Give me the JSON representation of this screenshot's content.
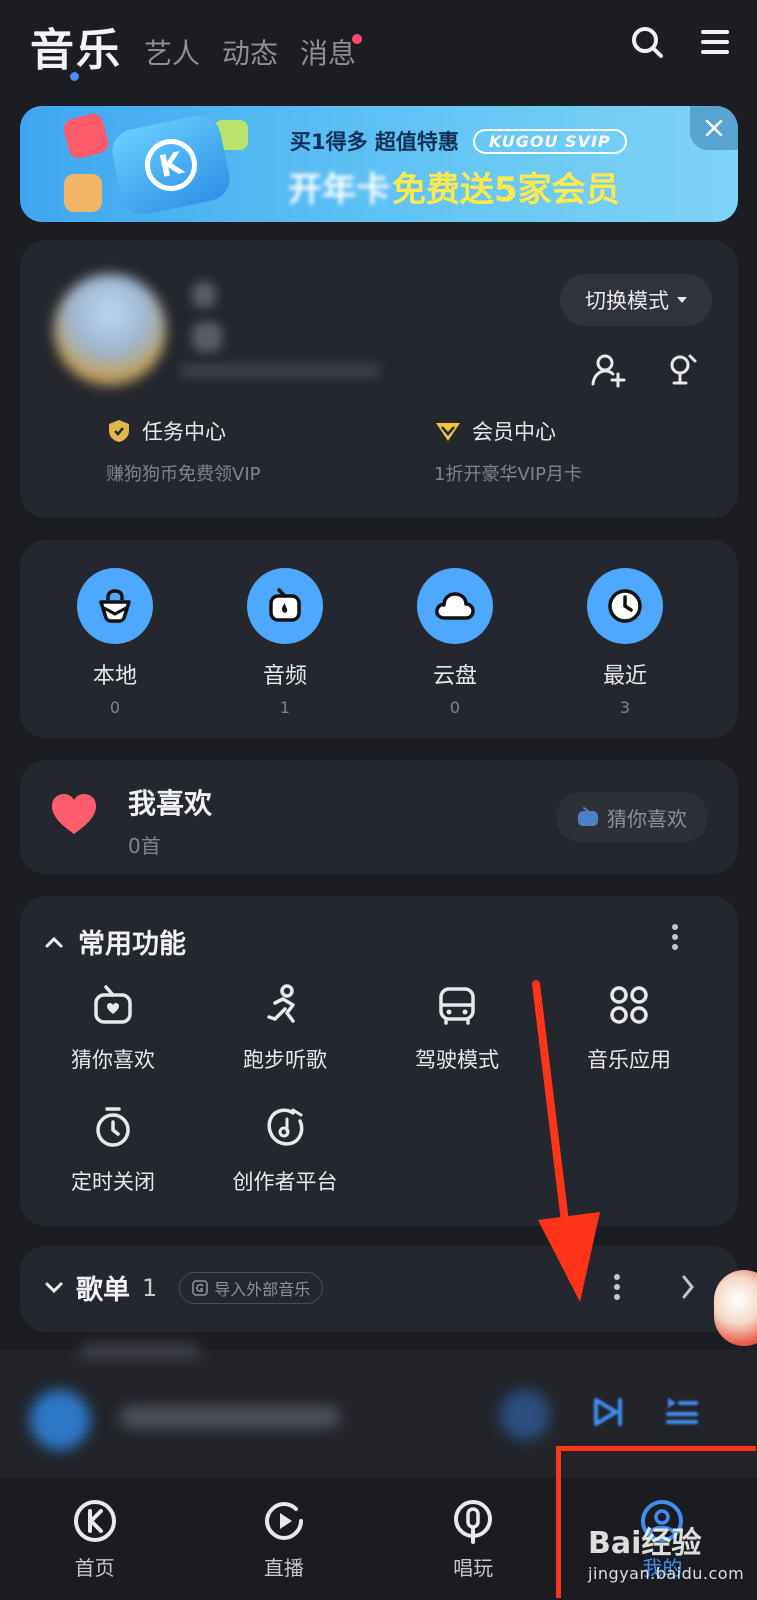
{
  "header": {
    "tabs": [
      {
        "label": "音乐",
        "active": true
      },
      {
        "label": "艺人"
      },
      {
        "label": "动态"
      },
      {
        "label": "消息",
        "has_dot": true
      }
    ],
    "search_icon": "search-icon",
    "menu_icon": "menu-icon"
  },
  "banner": {
    "line1": "买1得多 超值特惠",
    "brand_tag": "KUGOU SVIP",
    "line2_prefix": "开年卡",
    "line2_highlight": "免费送5家会员"
  },
  "profile": {
    "switch_mode": "切换模式",
    "task_center": {
      "title": "任务中心",
      "subtitle": "赚狗狗币免费领VIP"
    },
    "vip_center": {
      "title": "会员中心",
      "subtitle": "1折开豪华VIP月卡"
    }
  },
  "quick_access": [
    {
      "label": "本地",
      "count": "0",
      "icon": "local-bag-icon"
    },
    {
      "label": "音频",
      "count": "1",
      "icon": "audio-radio-icon"
    },
    {
      "label": "云盘",
      "count": "0",
      "icon": "cloud-icon"
    },
    {
      "label": "最近",
      "count": "3",
      "icon": "clock-icon"
    }
  ],
  "favorites": {
    "title": "我喜欢",
    "count": "0首",
    "guess_button": "猜你喜欢"
  },
  "common_functions": {
    "title": "常用功能",
    "items": [
      {
        "label": "猜你喜欢",
        "icon": "radio-heart-icon"
      },
      {
        "label": "跑步听歌",
        "icon": "running-icon"
      },
      {
        "label": "驾驶模式",
        "icon": "car-icon"
      },
      {
        "label": "音乐应用",
        "icon": "apps-grid-icon"
      },
      {
        "label": "定时关闭",
        "icon": "timer-icon"
      },
      {
        "label": "创作者平台",
        "icon": "creator-icon"
      }
    ]
  },
  "playlist": {
    "title": "歌单",
    "count": "1",
    "import_button": "导入外部音乐"
  },
  "bottom_nav": [
    {
      "label": "首页",
      "icon": "kugou-k-icon"
    },
    {
      "label": "直播",
      "icon": "live-play-icon"
    },
    {
      "label": "唱玩",
      "icon": "mic-icon"
    },
    {
      "label": "我的",
      "icon": "mine-icon",
      "active": true
    }
  ],
  "watermark": {
    "main": "Bai经验",
    "sub": "jingyan.baidu.com"
  },
  "colors": {
    "background": "#1c1d22",
    "card": "#25272e",
    "accent_blue": "#4ea8ff",
    "heart": "#ff5c6c",
    "annotation_red": "#ff3419"
  }
}
